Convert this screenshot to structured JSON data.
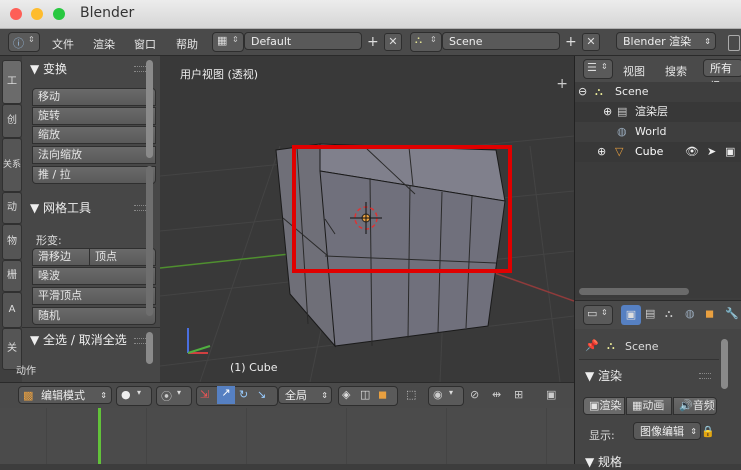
{
  "window": {
    "title": "Blender",
    "close_color": "#fe5f57",
    "min_color": "#febc2e",
    "max_color": "#28c840"
  },
  "topbar": {
    "menus": [
      "文件",
      "渲染",
      "窗口",
      "帮助"
    ],
    "layout": "Default",
    "scene": "Scene",
    "engine": "Blender 渲染"
  },
  "tabs": [
    "工",
    "创",
    "关系",
    "动",
    "物",
    "栅",
    "A",
    "关"
  ],
  "toolshelf": {
    "transform_header": "▼ 变换",
    "transform_buttons": [
      "移动",
      "旋转",
      "缩放",
      "法向缩放",
      "推 / 拉"
    ],
    "mesh_tools_header": "▼ 网格工具",
    "deform_label": "形变:",
    "deform_buttons": [
      "滑移边",
      "顶点",
      "噪波",
      "平滑顶点",
      "随机"
    ],
    "select_header": "▼ 全选 / 取消全选",
    "action_label": "动作"
  },
  "viewport": {
    "label": "用户视图 (透视)",
    "object_label": "(1) Cube",
    "highlight_color": "#e00000"
  },
  "bottombar": {
    "mode": "编辑模式",
    "orientation": "全局"
  },
  "outliner": {
    "view_label": "视图",
    "search_label": "搜索",
    "filter_label": "所有场",
    "items": [
      {
        "label": "Scene"
      },
      {
        "label": "渲染层"
      },
      {
        "label": "World"
      },
      {
        "label": "Cube"
      }
    ]
  },
  "properties": {
    "scene_label": "Scene",
    "render_header": "▼ 渲染",
    "render_btn": "渲染",
    "anim_btn": "动画",
    "audio_btn": "音频",
    "display_label": "显示:",
    "display_value": "图像编辑",
    "dimensions_header": "▼ 规格"
  }
}
